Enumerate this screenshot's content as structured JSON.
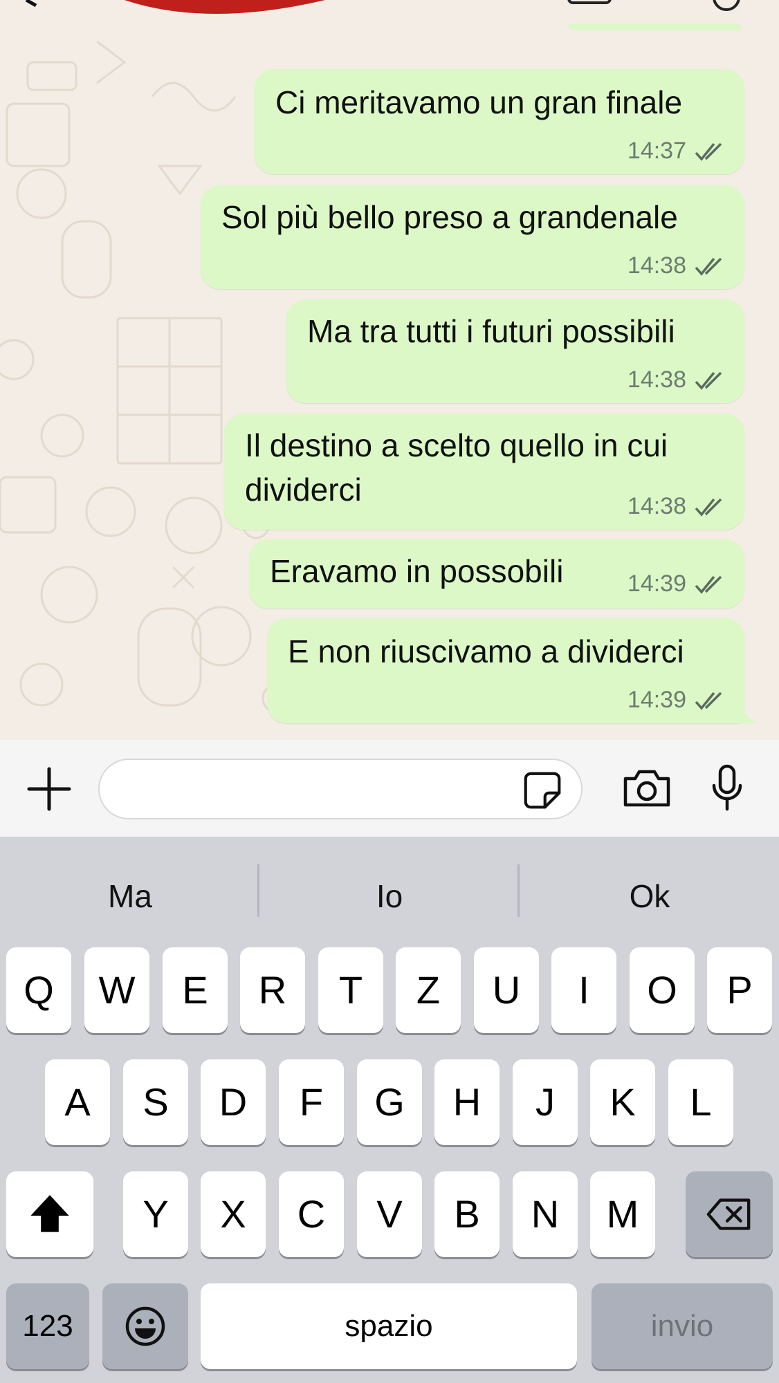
{
  "messages": [
    {
      "text": "Ci meritavamo un gran finale",
      "time": "14:37",
      "status": "read"
    },
    {
      "text": "Sol più bello preso a grandenale",
      "time": "14:38",
      "status": "read"
    },
    {
      "text": "Ma tra tutti i futuri possibili",
      "time": "14:38",
      "status": "read"
    },
    {
      "text_line1": "Il destino a scelto quello in cui",
      "text_line2": "dividerci",
      "time": "14:38",
      "status": "read"
    },
    {
      "text": "Eravamo in possobili",
      "time": "14:39",
      "status": "read"
    },
    {
      "text": "E non riuscivamo a dividerci",
      "time": "14:39",
      "status": "read"
    }
  ],
  "input": {
    "placeholder": ""
  },
  "suggestions": [
    "Ma",
    "Io",
    "Ok"
  ],
  "keyboard": {
    "row1": [
      "Q",
      "W",
      "E",
      "R",
      "T",
      "Z",
      "U",
      "I",
      "O",
      "P"
    ],
    "row2": [
      "A",
      "S",
      "D",
      "F",
      "G",
      "H",
      "J",
      "K",
      "L"
    ],
    "row3": [
      "Y",
      "X",
      "C",
      "V",
      "B",
      "N",
      "M"
    ],
    "numbers_label": "123",
    "space_label": "spazio",
    "return_label": "invio"
  },
  "colors": {
    "bubble_outgoing": "#dcf8c6",
    "chat_background": "#f3ede5",
    "keyboard_background": "#d1d3d9",
    "tick_color": "#5b6b5f"
  },
  "icons": [
    "plus-icon",
    "sticker-icon",
    "camera-icon",
    "microphone-icon",
    "shift-icon",
    "backspace-icon",
    "emoji-icon",
    "read-receipt-icon"
  ]
}
